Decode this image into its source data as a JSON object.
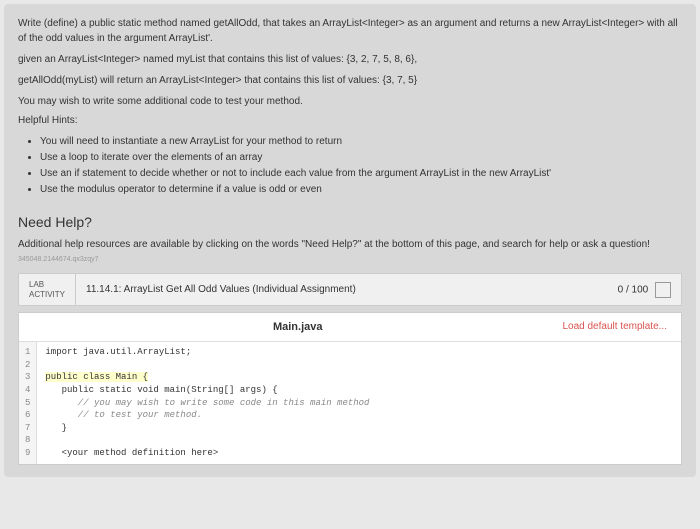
{
  "instructions": {
    "p1": "Write (define) a public static method named getAllOdd, that takes an ArrayList<Integer> as an argument and returns a new ArrayList<Integer> with all of the odd values in the argument ArrayList'.",
    "p2": "given an ArrayList<Integer> named myList that contains this list of values: {3, 2, 7, 5, 8, 6},",
    "p3": "getAllOdd(myList) will return an ArrayList<Integer> that contains this list of values: {3, 7, 5}",
    "p4": "You may wish to write some additional code to test your method.",
    "hints_title": "Helpful Hints:",
    "hints": [
      "You will need to instantiate a new ArrayList for your method to return",
      "Use a loop to iterate over the elements of an array",
      "Use an if statement to decide whether or not to include each value from the argument ArrayList in the new ArrayList'",
      "Use the modulus operator to determine if a value is odd or even"
    ]
  },
  "help": {
    "title": "Need Help?",
    "text": "Additional help resources are available by clicking on the words \"Need Help?\" at the bottom of this page, and search for help or ask a question!",
    "tiny": "345048.2144674.qx3zqy7"
  },
  "activity": {
    "label_line1": "LAB",
    "label_line2": "ACTIVITY",
    "title": "11.14.1: ArrayList Get All Odd Values (Individual Assignment)",
    "score": "0 / 100"
  },
  "editor": {
    "filename": "Main.java",
    "load_template": "Load default template...",
    "lines": [
      "import java.util.ArrayList;",
      "",
      "public class Main {",
      "   public static void main(String[] args) {",
      "      // you may wish to write some code in this main method",
      "      // to test your method.",
      "   }",
      "",
      "   <your method definition here>"
    ]
  }
}
